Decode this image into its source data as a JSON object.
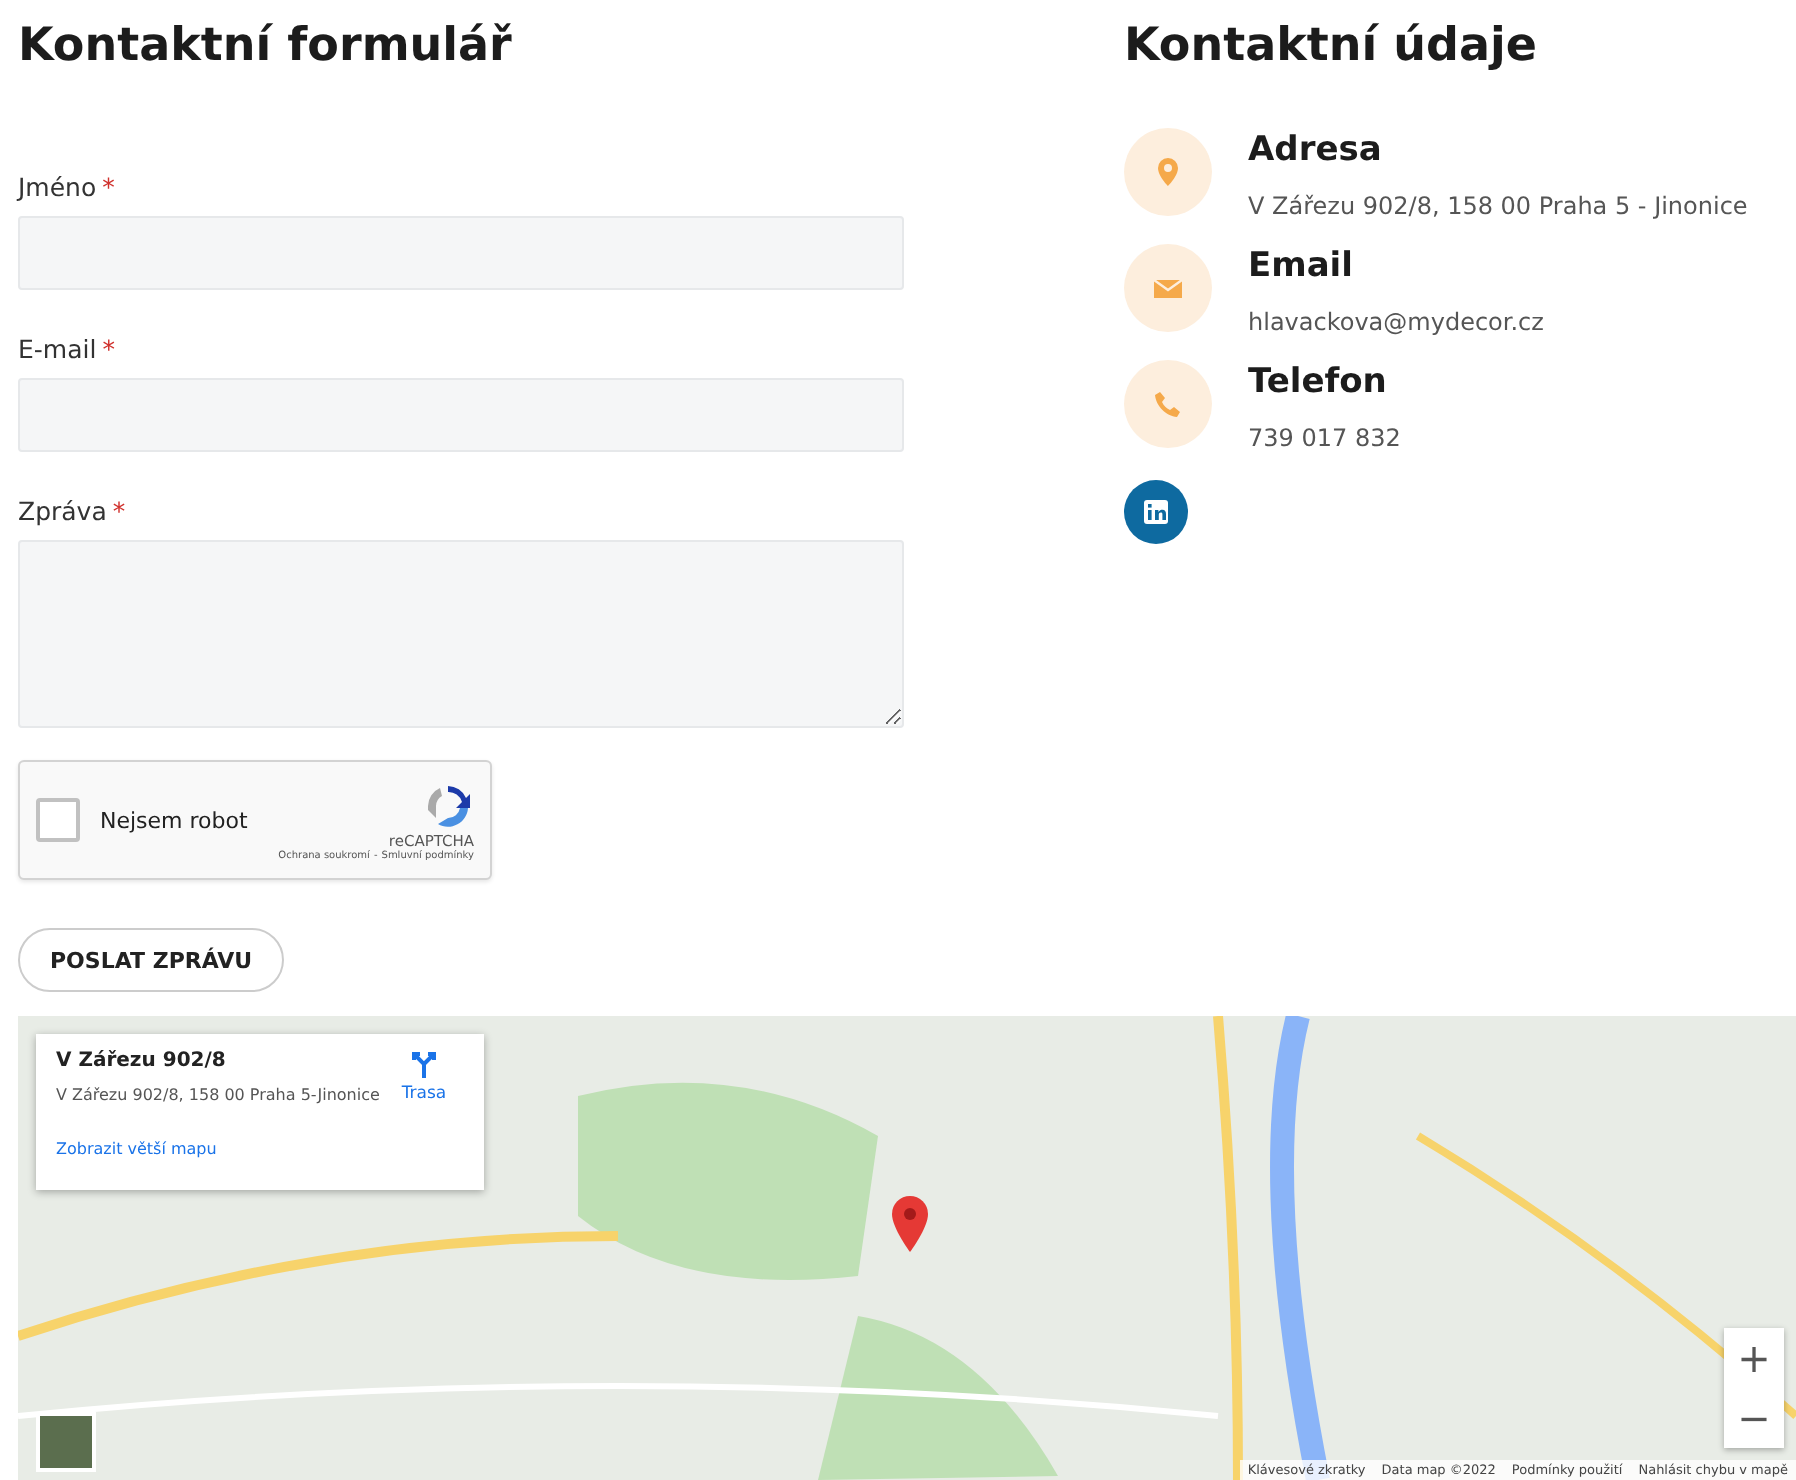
{
  "form": {
    "title": "Kontaktní formulář",
    "fields": [
      {
        "label": "Jméno",
        "required_mark": "*",
        "kind": "input"
      },
      {
        "label": "E-mail",
        "required_mark": "*",
        "kind": "input"
      },
      {
        "label": "Zpráva",
        "required_mark": "*",
        "kind": "textarea"
      }
    ],
    "captcha": {
      "label": "Nejsem robot",
      "checked": false,
      "brand": "reCAPTCHA",
      "privacy": "Ochrana soukromí",
      "separator": "-",
      "terms": "Smluvní podmínky"
    },
    "submit": "POSLAT ZPRÁVU"
  },
  "contact": {
    "title": "Kontaktní údaje",
    "items": [
      {
        "kind": "address",
        "heading": "Adresa",
        "value": "V Zářezu 902/8, 158 00 Praha 5 - Jinonice"
      },
      {
        "kind": "email",
        "heading": "Email",
        "value": "hlavackova@mydecor.cz"
      },
      {
        "kind": "phone",
        "heading": "Telefon",
        "value": "739 017 832"
      }
    ],
    "social": [
      {
        "kind": "linkedin"
      }
    ]
  },
  "map": {
    "card": {
      "title": "V Zářezu 902/8",
      "address": "V Zářezu 902/8, 158 00 Praha 5-Jinonice",
      "directions": "Trasa",
      "larger_map": "Zobrazit větší mapu"
    },
    "zoom_in": "+",
    "zoom_out": "−",
    "footer": [
      "Klávesové zkratky",
      "Data map ©2022",
      "Podmínky použití",
      "Nahlásit chybu v mapě"
    ]
  }
}
